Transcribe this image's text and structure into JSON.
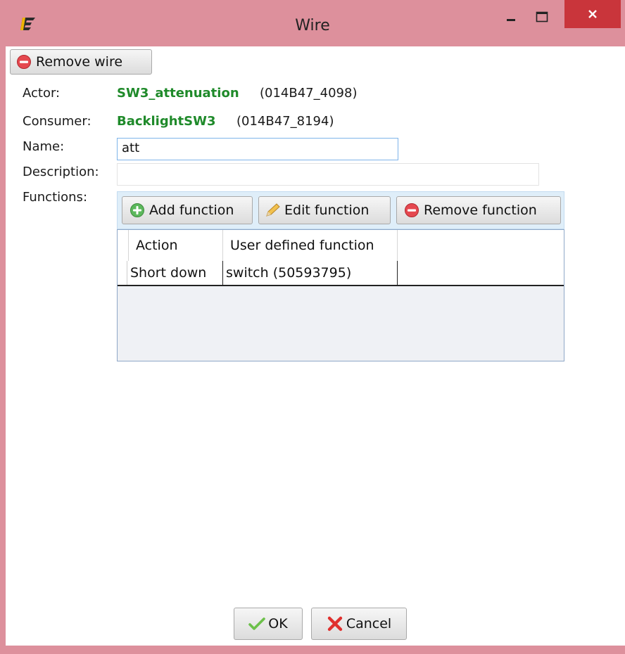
{
  "window": {
    "title": "Wire",
    "controls": {
      "minimize": "minimize",
      "maximize": "maximize",
      "close": "close"
    }
  },
  "toolbar": {
    "remove_wire_label": "Remove wire"
  },
  "form": {
    "actor_label": "Actor:",
    "actor_name": "SW3_attenuation",
    "actor_id": "(014B47_4098)",
    "consumer_label": "Consumer:",
    "consumer_name": "BacklightSW3",
    "consumer_id": "(014B47_8194)",
    "name_label": "Name:",
    "name_value": "att",
    "description_label": "Description:",
    "description_value": "",
    "functions_label": "Functions:"
  },
  "functions": {
    "add_label": "Add function",
    "edit_label": "Edit function",
    "remove_label": "Remove function",
    "columns": [
      "Action",
      "User defined function"
    ],
    "rows": [
      {
        "action": "Short down",
        "function": "switch (50593795)"
      }
    ]
  },
  "footer": {
    "ok_label": "OK",
    "cancel_label": "Cancel"
  },
  "colors": {
    "accent_green": "#1f8a2a",
    "title_bar": "#dd909c",
    "close_red": "#c9353b"
  }
}
